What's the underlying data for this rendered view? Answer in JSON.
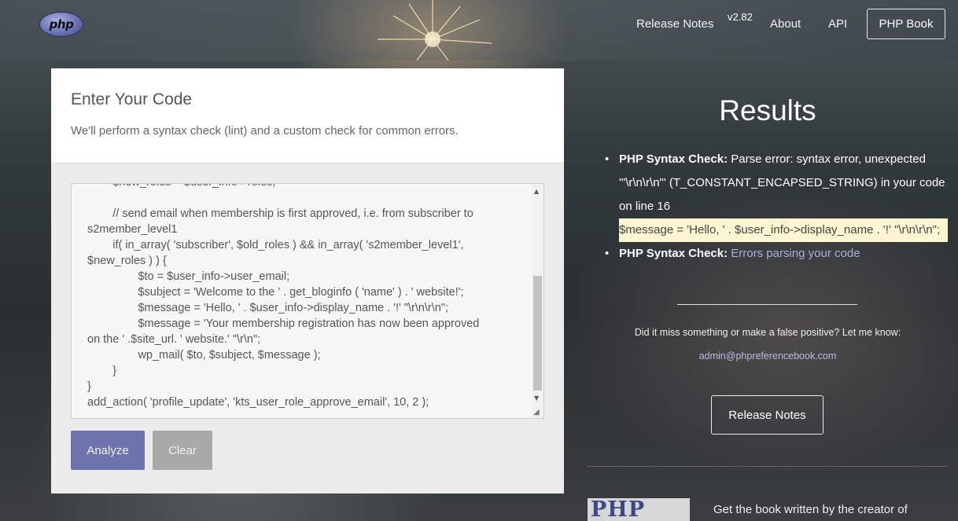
{
  "nav": {
    "logo_text": "php",
    "release_notes": "Release Notes",
    "version": "v2.82",
    "about": "About",
    "api": "API",
    "book": "PHP Book"
  },
  "editor": {
    "title": "Enter Your Code",
    "subtitle": "We'll perform a syntax check (lint) and a custom check for common errors.",
    "code_lines": [
      "        $new_roles = $user_info->roles;",
      "",
      "        // send email when membership is first approved, i.e. from subscriber to",
      "s2member_level1",
      "        if( in_array( 'subscriber', $old_roles ) && in_array( 's2member_level1',",
      "$new_roles ) ) {",
      "                $to = $user_info->user_email;",
      "                $subject = 'Welcome to the ' . get_bloginfo ( 'name' ) . ' website!';",
      "                $message = 'Hello, ' . $user_info->display_name . '!' \"\\r\\n\\r\\n\";",
      "                $message = 'Your membership registration has now been approved",
      "on the ' .$site_url. ' website.' \"\\r\\n\";",
      "                wp_mail( $to, $subject, $message );",
      "        }",
      "}",
      "add_action( 'profile_update', 'kts_user_role_approve_email', 10, 2 );"
    ],
    "analyze_label": "Analyze",
    "clear_label": "Clear"
  },
  "results": {
    "title": "Results",
    "items": [
      {
        "label": "PHP Syntax Check:",
        "text": "Parse error: syntax error, unexpected '\"\\r\\n\\r\\n\"' (T_CONSTANT_ENCAPSED_STRING) in your code on line 16",
        "highlight": "$message = 'Hello, ' . $user_info->display_name . '!' \"\\r\\n\\r\\n\";"
      },
      {
        "label": "PHP Syntax Check:",
        "link": "Errors parsing your code"
      }
    ],
    "feedback": "Did it miss something or make a false positive? Let me know:",
    "email": "admin@phpreferencebook.com",
    "release_notes_button": "Release Notes",
    "book_image_text": "PHP",
    "book_text": "Get the book written by the creator of"
  },
  "colors": {
    "analyze_bg": "#6e72ad",
    "clear_bg": "#a9a9a9",
    "highlight_bg": "#fff5d1",
    "link": "#a9aee0"
  }
}
